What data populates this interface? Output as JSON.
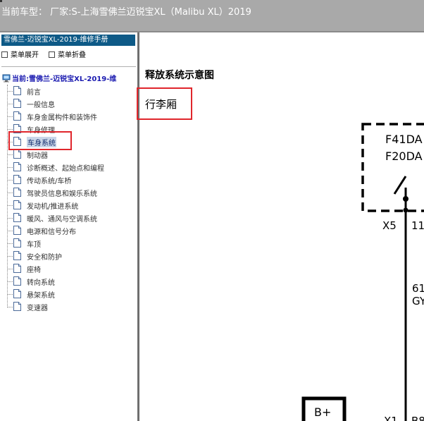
{
  "header": {
    "vehicle_info": "当前车型： 厂家:S-上海雪佛兰迈锐宝XL（Malibu XL）2019"
  },
  "sidebar": {
    "manual_title": "雪佛兰-迈锐宝XL-2019-维修手册",
    "expand_label": "菜单展开",
    "collapse_label": "菜单折叠",
    "root_label": "当前:雪佛兰-迈锐宝XL-2019-维",
    "items": [
      {
        "label": "前言"
      },
      {
        "label": "一般信息"
      },
      {
        "label": "车身金属构件和装饰件"
      },
      {
        "label": "车身修理"
      },
      {
        "label": "车身系统"
      },
      {
        "label": "制动器"
      },
      {
        "label": "诊断概述、起始点和编程"
      },
      {
        "label": "传动系统/车桥"
      },
      {
        "label": "驾驶员信息和娱乐系统"
      },
      {
        "label": "发动机/推进系统"
      },
      {
        "label": "暖风、通风与空调系统"
      },
      {
        "label": "电源和信号分布"
      },
      {
        "label": "车顶"
      },
      {
        "label": "安全和防护"
      },
      {
        "label": "座椅"
      },
      {
        "label": "转向系统"
      },
      {
        "label": "悬架系统"
      },
      {
        "label": "变速器"
      }
    ],
    "selected_index": 4
  },
  "content": {
    "title": "释放系统示意图",
    "subtitle": "行李厢",
    "diagram": {
      "fuse_label_1": "F41DA",
      "fuse_label_2": "F20DA",
      "connector_x5": "X5",
      "pin_11": "11",
      "wire_61": "61",
      "wire_color": "GY",
      "power_label": "B+",
      "connector_x1": "X1",
      "pin_b": "B8"
    }
  },
  "colors": {
    "header_bg": "#a9a9a9",
    "manual_title_bg": "#0e5a87",
    "highlight_red": "#e0262c",
    "root_text": "#1a1ab0"
  }
}
